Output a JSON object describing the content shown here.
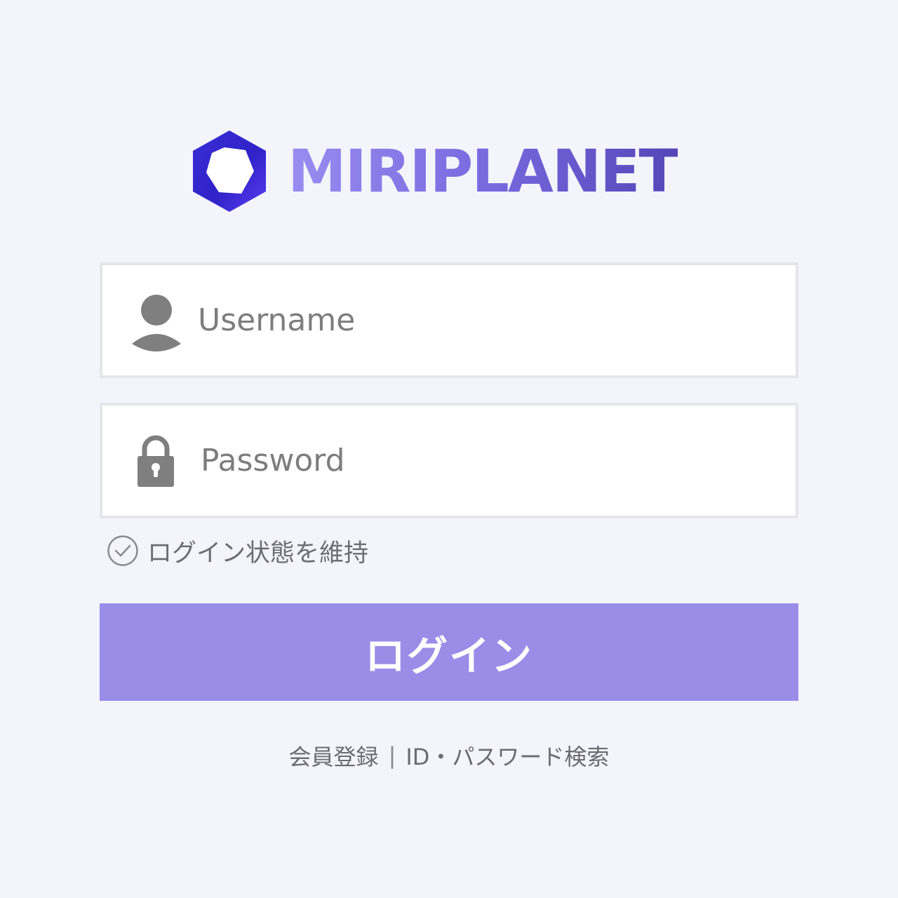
{
  "brand": {
    "name": "MIRIPLANET",
    "logo_icon": "hexagon-logo-icon",
    "colors": {
      "primary_dark": "#2d2bc4",
      "primary": "#4733e6",
      "text_gradient_start": "#9a8cf0",
      "text_gradient_end": "#5545b8"
    }
  },
  "login_form": {
    "username": {
      "placeholder": "Username",
      "value": "",
      "icon": "user-icon"
    },
    "password": {
      "placeholder": "Password",
      "value": "",
      "icon": "lock-icon"
    },
    "remember_me": {
      "label": "ログイン状態を維持",
      "checked": false,
      "icon": "check-circle-icon"
    },
    "submit_label": "ログイン",
    "submit_color": "#9b8ce8"
  },
  "footer": {
    "register_label": "会員登録",
    "separator": "|",
    "recover_label": "ID・パスワード検索"
  }
}
